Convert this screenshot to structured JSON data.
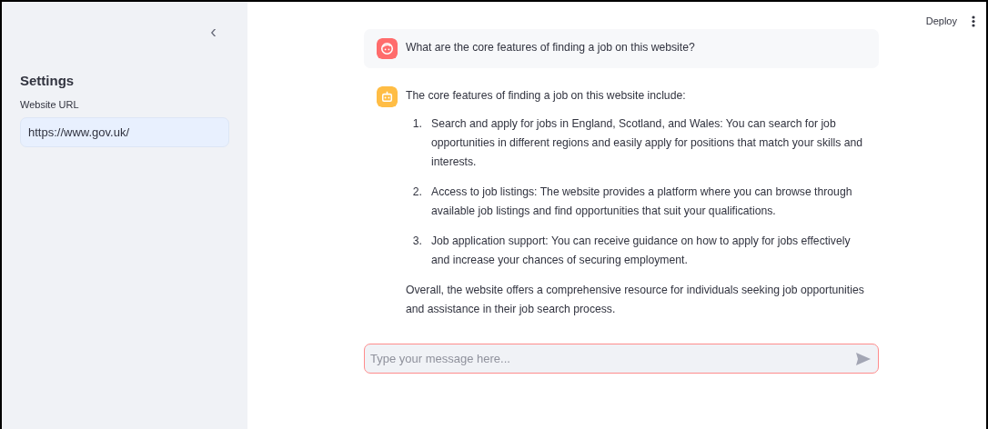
{
  "sidebar": {
    "collapse_icon": "‹",
    "title": "Settings",
    "url_field": {
      "label": "Website URL",
      "value": "https://www.gov.uk/"
    }
  },
  "header": {
    "deploy": "Deploy"
  },
  "messages": [
    {
      "kind": "user",
      "text": "What are the core features of finding a job on this website?"
    },
    {
      "kind": "assistant",
      "intro": "The core features of finding a job on this website include:",
      "items": [
        {
          "number": "1.",
          "text": "Search and apply for jobs in England, Scotland, and Wales: You can search for job opportunities in different regions and easily apply for positions that match your skills and interests."
        },
        {
          "number": "2.",
          "text": "Access to job listings: The website provides a platform where you can browse through available job listings and find opportunities that suit your qualifications."
        },
        {
          "number": "3.",
          "text": "Job application support: You can receive guidance on how to apply for jobs effectively and increase your chances of securing employment."
        }
      ],
      "outro": "Overall, the website offers a comprehensive resource for individuals seeking job opportunities and assistance in their job search process."
    }
  ],
  "chat_input": {
    "placeholder": "Type your message here..."
  }
}
